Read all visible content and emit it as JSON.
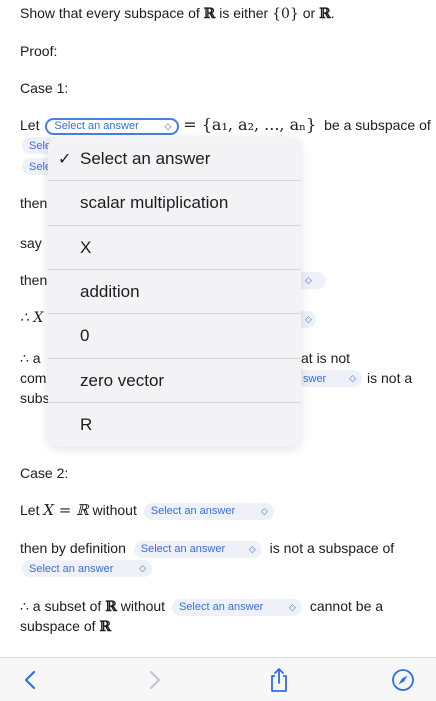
{
  "question": {
    "prefix": "Show that every subspace of ",
    "R": "ℝ",
    "mid": " is either ",
    "zero_set": "{0}",
    "or": " or ",
    "suffix": "."
  },
  "proof_label": "Proof:",
  "case1": {
    "label": "Case 1:",
    "let": "Let",
    "set_expr": "= {a₁, a₂, ..., aₙ}",
    "be_subspace_of": "be a subspace of",
    "then1": "then",
    "say": "say",
    "then2": "then",
    "therefore_x": "∴ X",
    "therefore_a": "∴ a",
    "com": "com",
    "subs": "subs",
    "at_is_not": "at is not",
    "is_not_a": "is not a"
  },
  "case2": {
    "label": "Case 2:",
    "let": "Let ",
    "x_eq_r": "X = ℝ",
    "without": " without",
    "then_by_def": "then by definition",
    "is_not_subspace_of": "is not a subspace of",
    "subset_of": "∴ a subset of ",
    "R": "ℝ",
    "without2": " without",
    "cannot_be": "cannot be a",
    "subspace_of": "subspace of ",
    "R2": "ℝ"
  },
  "selects": {
    "placeholder": "Select an answer",
    "truncated": "Sele",
    "truncated_answer": "swer"
  },
  "dropdown": {
    "options": [
      "Select an answer",
      "scalar multiplication",
      "X",
      "addition",
      "0",
      "zero vector",
      "R"
    ],
    "selected_index": 0,
    "check": "✓"
  },
  "toolbar": {
    "icons": [
      "back-icon",
      "forward-icon",
      "share-icon",
      "compass-icon"
    ],
    "accent": "#2f6fe4",
    "disabled": "#c7c7cc"
  }
}
